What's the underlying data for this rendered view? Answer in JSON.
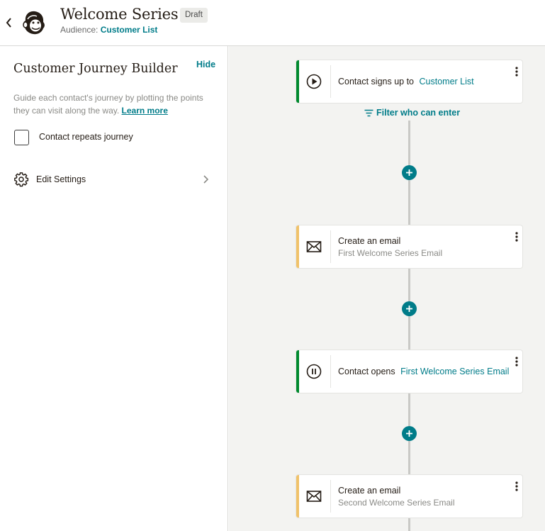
{
  "header": {
    "title": "Welcome Series",
    "status_badge": "Draft",
    "audience_label": "Audience:",
    "audience_name": "Customer List"
  },
  "sidebar": {
    "title": "Customer Journey Builder",
    "hide_label": "Hide",
    "description": "Guide each contact's journey by plotting the points they can visit along the way.",
    "learn_more": "Learn more",
    "repeat_label": "Contact repeats journey",
    "repeat_checked": false,
    "settings_label": "Edit Settings"
  },
  "canvas": {
    "filter_label": "Filter who can enter",
    "steps": [
      {
        "kind": "trigger",
        "icon": "play-icon",
        "accent": "#00892e",
        "text": "Contact signs up to",
        "link": "Customer List"
      },
      {
        "kind": "action",
        "icon": "envelope-icon",
        "accent": "#f0c26a",
        "text": "Create an email",
        "subtext": "First Welcome Series Email"
      },
      {
        "kind": "rule",
        "icon": "pause-icon",
        "accent": "#00892e",
        "text": "Contact opens",
        "link": "First Welcome Series Email"
      },
      {
        "kind": "action",
        "icon": "envelope-icon",
        "accent": "#f0c26a",
        "text": "Create an email",
        "subtext": "Second Welcome Series Email"
      }
    ]
  },
  "colors": {
    "brand_teal": "#007c89",
    "trigger_green": "#00892e",
    "action_yellow": "#f0c26a",
    "canvas_bg": "#f3f3f1"
  }
}
